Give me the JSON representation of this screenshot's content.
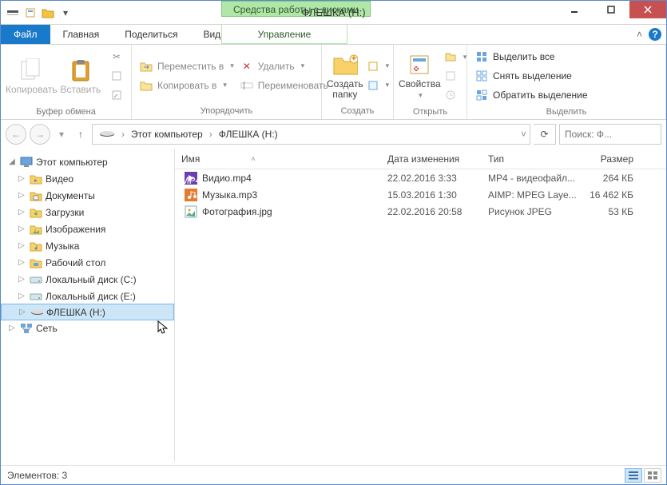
{
  "window": {
    "title": "ФЛЕШКА (H:)",
    "disk_tools": "Средства работы с дисками"
  },
  "tabs": {
    "file": "Файл",
    "home": "Главная",
    "share": "Поделиться",
    "view": "Вид",
    "manage": "Управление"
  },
  "ribbon": {
    "clipboard": {
      "copy": "Копировать",
      "paste": "Вставить",
      "group": "Буфер обмена"
    },
    "organize": {
      "moveTo": "Переместить в",
      "copyTo": "Копировать в",
      "delete": "Удалить",
      "rename": "Переименовать",
      "group": "Упорядочить"
    },
    "new": {
      "newFolder": "Создать папку",
      "group": "Создать"
    },
    "open": {
      "properties": "Свойства",
      "group": "Открыть"
    },
    "select": {
      "selectAll": "Выделить все",
      "selectNone": "Снять выделение",
      "invert": "Обратить выделение",
      "group": "Выделить"
    }
  },
  "address": {
    "thisPc": "Этот компьютер",
    "current": "ФЛЕШКА (H:)",
    "searchPlaceholder": "Поиск: Ф..."
  },
  "nav": {
    "thisPc": "Этот компьютер",
    "items": [
      {
        "label": "Видео",
        "icon": "video"
      },
      {
        "label": "Документы",
        "icon": "docs"
      },
      {
        "label": "Загрузки",
        "icon": "downloads"
      },
      {
        "label": "Изображения",
        "icon": "pictures"
      },
      {
        "label": "Музыка",
        "icon": "music"
      },
      {
        "label": "Рабочий стол",
        "icon": "desktop"
      },
      {
        "label": "Локальный диск (C:)",
        "icon": "hdd"
      },
      {
        "label": "Локальный диск (E:)",
        "icon": "hdd"
      },
      {
        "label": "ФЛЕШКА (H:)",
        "icon": "usb"
      }
    ],
    "network": "Сеть"
  },
  "columns": {
    "name": "Имя",
    "date": "Дата изменения",
    "type": "Тип",
    "size": "Размер"
  },
  "files": [
    {
      "name": "Видио.mp4",
      "date": "22.02.2016 3:33",
      "type": "MP4 - видеофайл...",
      "size": "264 КБ",
      "icon": "mp4"
    },
    {
      "name": "Музыка.mp3",
      "date": "15.03.2016 1:30",
      "type": "AIMP: MPEG Laye...",
      "size": "16 462 КБ",
      "icon": "mp3"
    },
    {
      "name": "Фотография.jpg",
      "date": "22.02.2016 20:58",
      "type": "Рисунок JPEG",
      "size": "53 КБ",
      "icon": "jpg"
    }
  ],
  "status": {
    "count": "Элементов: 3"
  }
}
